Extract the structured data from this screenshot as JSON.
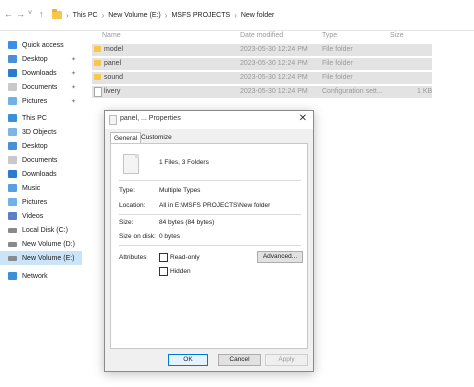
{
  "address_bar": {
    "crumbs": [
      "This PC",
      "New Volume (E:)",
      "MSFS PROJECTS",
      "New folder"
    ]
  },
  "columns": {
    "name": "Name",
    "date": "Date modified",
    "type": "Type",
    "size": "Size"
  },
  "files": [
    {
      "name": "model",
      "date": "2023-05-30 12:24 PM",
      "type": "File folder",
      "size": "",
      "kind": "folder"
    },
    {
      "name": "panel",
      "date": "2023-05-30 12:24 PM",
      "type": "File folder",
      "size": "",
      "kind": "folder"
    },
    {
      "name": "sound",
      "date": "2023-05-30 12:24 PM",
      "type": "File folder",
      "size": "",
      "kind": "folder"
    },
    {
      "name": "livery",
      "date": "2023-05-30 12:24 PM",
      "type": "Configuration sett...",
      "size": "1 KB",
      "kind": "file"
    }
  ],
  "sidebar": {
    "items": [
      {
        "label": "Quick access",
        "icon": "star-icon",
        "pinned": false
      },
      {
        "label": "Desktop",
        "icon": "desktop-icon",
        "pinned": true
      },
      {
        "label": "Downloads",
        "icon": "downloads-icon",
        "pinned": true
      },
      {
        "label": "Documents",
        "icon": "documents-icon",
        "pinned": true
      },
      {
        "label": "Pictures",
        "icon": "pictures-icon",
        "pinned": true
      },
      {
        "label": "This PC",
        "icon": "computer-icon",
        "pinned": false
      },
      {
        "label": "3D Objects",
        "icon": "3d-objects-icon",
        "pinned": false
      },
      {
        "label": "Desktop",
        "icon": "desktop-icon",
        "pinned": false
      },
      {
        "label": "Documents",
        "icon": "documents-icon",
        "pinned": false
      },
      {
        "label": "Downloads",
        "icon": "downloads-icon",
        "pinned": false
      },
      {
        "label": "Music",
        "icon": "music-icon",
        "pinned": false
      },
      {
        "label": "Pictures",
        "icon": "pictures-icon",
        "pinned": false
      },
      {
        "label": "Videos",
        "icon": "videos-icon",
        "pinned": false
      },
      {
        "label": "Local Disk (C:)",
        "icon": "drive-icon",
        "pinned": false
      },
      {
        "label": "New Volume (D:)",
        "icon": "drive-icon",
        "pinned": false
      },
      {
        "label": "New Volume (E:)",
        "icon": "drive-icon",
        "pinned": false
      },
      {
        "label": "Network",
        "icon": "network-icon",
        "pinned": false
      }
    ]
  },
  "dialog": {
    "title": "panel, ... Properties",
    "tabs": [
      "General",
      "Customize"
    ],
    "summary": "1 Files, 3 Folders",
    "type_label": "Type:",
    "type_value": "Multiple Types",
    "location_label": "Location:",
    "location_value": "All in E:\\MSFS PROJECTS\\New folder",
    "size_label": "Size:",
    "size_value": "84 bytes (84 bytes)",
    "size_on_disk_label": "Size on disk:",
    "size_on_disk_value": "0 bytes",
    "attributes_label": "Attributes",
    "readonly_label": "Read-only",
    "hidden_label": "Hidden",
    "advanced_label": "Advanced...",
    "ok_label": "OK",
    "cancel_label": "Cancel",
    "apply_label": "Apply"
  },
  "colors": {
    "selection": "#cce4f7",
    "row_selected": "#e3e3e3",
    "folder": "#f5c84c",
    "accent": "#0078d7"
  }
}
